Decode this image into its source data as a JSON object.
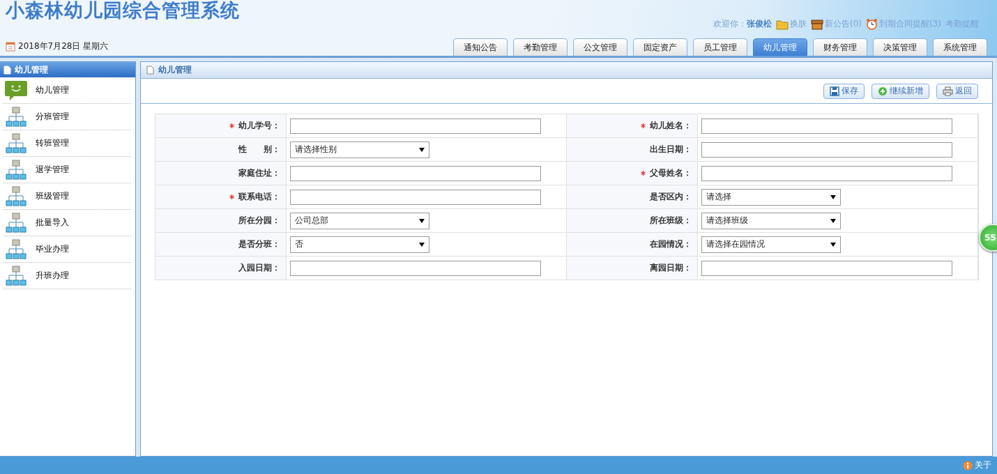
{
  "app_title": "小森林幼儿园综合管理系统",
  "date": "2018年7月28日 星期六",
  "user_bar": {
    "greeting": "欢迎你：",
    "user": "张俊松",
    "links": [
      {
        "kind": "skin",
        "label": "换肤"
      },
      {
        "kind": "notice",
        "label": "新公告(0)"
      },
      {
        "kind": "alarm",
        "label": "到期合同提醒(3)"
      },
      {
        "kind": "plain",
        "label": "考勤提醒"
      }
    ]
  },
  "tabs": [
    {
      "label": "通知公告",
      "selected": false
    },
    {
      "label": "考勤管理",
      "selected": false
    },
    {
      "label": "公文管理",
      "selected": false
    },
    {
      "label": "固定资产",
      "selected": false
    },
    {
      "label": "员工管理",
      "selected": false
    },
    {
      "label": "幼儿管理",
      "selected": true
    },
    {
      "label": "财务管理",
      "selected": false
    },
    {
      "label": "决策管理",
      "selected": false
    },
    {
      "label": "系统管理",
      "selected": false
    }
  ],
  "sidebar": {
    "title": "幼儿管理",
    "items": [
      {
        "label": "幼儿管理",
        "kind": "chat"
      },
      {
        "label": "分班管理",
        "kind": "tree"
      },
      {
        "label": "转班管理",
        "kind": "tree"
      },
      {
        "label": "退学管理",
        "kind": "tree"
      },
      {
        "label": "班级管理",
        "kind": "tree"
      },
      {
        "label": "批量导入",
        "kind": "tree"
      },
      {
        "label": "毕业办理",
        "kind": "tree"
      },
      {
        "label": "升班办理",
        "kind": "tree"
      }
    ]
  },
  "panel": {
    "title": "幼儿管理",
    "buttons": [
      {
        "kind": "save",
        "label": "保存"
      },
      {
        "kind": "add",
        "label": "继续新增"
      },
      {
        "kind": "print",
        "label": "返回"
      }
    ],
    "fields": [
      {
        "label": "幼儿学号：",
        "required": true,
        "kind": "text"
      },
      {
        "label": "幼儿姓名：",
        "required": true,
        "kind": "text"
      },
      {
        "label": "性　　别：",
        "required": false,
        "kind": "select",
        "value": "请选择性别"
      },
      {
        "label": "出生日期：",
        "required": false,
        "kind": "text"
      },
      {
        "label": "家庭住址：",
        "required": false,
        "kind": "text"
      },
      {
        "label": "父母姓名：",
        "required": true,
        "kind": "text"
      },
      {
        "label": "联系电话：",
        "required": true,
        "kind": "text"
      },
      {
        "label": "是否区内：",
        "required": false,
        "kind": "select",
        "value": "请选择"
      },
      {
        "label": "所在分园：",
        "required": false,
        "kind": "select",
        "value": "公司总部"
      },
      {
        "label": "所在班级：",
        "required": false,
        "kind": "select",
        "value": "请选择班级"
      },
      {
        "label": "是否分班：",
        "required": false,
        "kind": "select",
        "value": "否"
      },
      {
        "label": "在园情况：",
        "required": false,
        "kind": "select",
        "value": "请选择在园情况"
      },
      {
        "label": "入园日期：",
        "required": false,
        "kind": "text"
      },
      {
        "label": "离园日期：",
        "required": false,
        "kind": "text"
      }
    ]
  },
  "float_badge": "55",
  "footer": {
    "link": "关于"
  }
}
